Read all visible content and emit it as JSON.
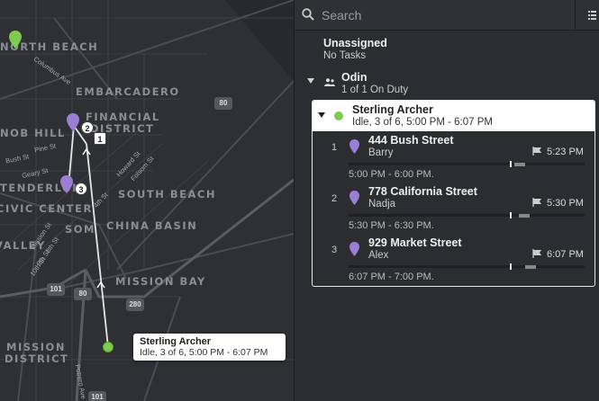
{
  "map": {
    "neighborhoods": [
      "NORTH BEACH",
      "EMBARCADERO",
      "FINANCIAL",
      "DISTRICT",
      "NOB HILL",
      "TENDERLOIN",
      "CIVIC CENTER",
      "SOUTH BEACH",
      "CHINA BASIN",
      "SOM",
      "VALLEY",
      "MISSION BAY",
      "MISSION",
      "DISTRICT"
    ],
    "streets": [
      "Columbus Ave",
      "Pine St",
      "Bush St",
      "Geary St",
      "Howard St",
      "Folsom St",
      "4th St",
      "Mission St",
      "8th St",
      "9th St",
      "10th St",
      "Potrero Ave"
    ],
    "shields": [
      "80",
      "101",
      "80",
      "280",
      "101"
    ],
    "stop_numbers": [
      "2",
      "1",
      "3"
    ],
    "tooltip": {
      "name": "Sterling Archer",
      "status": "Idle, 3 of 6, 5:00 PM - 6:07 PM"
    },
    "colors": {
      "agent": "#7dcc4d",
      "pin": "#9b7fd4"
    }
  },
  "search": {
    "placeholder": "Search"
  },
  "unassigned": {
    "title": "Unassigned",
    "subtitle": "No Tasks"
  },
  "team": {
    "name": "Odin",
    "status": "1 of 1 On Duty"
  },
  "agent": {
    "name": "Sterling Archer",
    "status": "Idle, 3 of 6, 5:00 PM - 6:07 PM",
    "tasks": [
      {
        "num": "1",
        "address": "444 Bush Street",
        "recipient": "Barry",
        "eta": "5:23 PM",
        "window": "5:00 PM - 6:00 PM."
      },
      {
        "num": "2",
        "address": "778 California Street",
        "recipient": "Nadja",
        "eta": "5:30 PM",
        "window": "5:30 PM - 6:30 PM."
      },
      {
        "num": "3",
        "address": "929 Market Street",
        "recipient": "Alex",
        "eta": "6:07 PM",
        "window": "6:07 PM - 7:00 PM."
      }
    ]
  }
}
